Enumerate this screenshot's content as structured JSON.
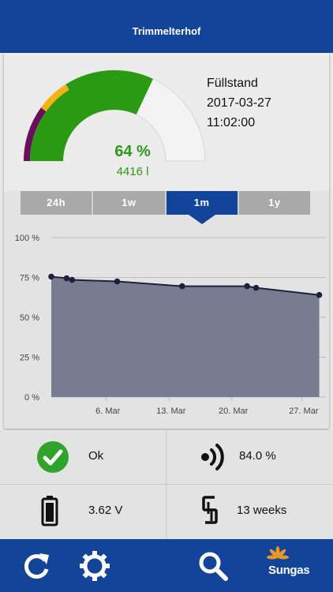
{
  "header": {
    "title": "Trimmelterhof"
  },
  "gauge": {
    "level_percent": 64,
    "percent_text": "64 %",
    "liters_text": "4416 l",
    "colors": {
      "fill": "#2a9a12",
      "warning": "#f5b214",
      "critical": "#6b0f5c",
      "empty": "#f3f3f3"
    }
  },
  "info": {
    "label": "Füllstand",
    "date": "2017-03-27",
    "time": "11:02:00"
  },
  "tabs": [
    {
      "label": "24h",
      "active": false
    },
    {
      "label": "1w",
      "active": false
    },
    {
      "label": "1m",
      "active": true
    },
    {
      "label": "1y",
      "active": false
    }
  ],
  "chart_data": {
    "type": "area",
    "x_ticks": [
      "6. Mar",
      "13. Mar",
      "20. Mar",
      "27. Mar"
    ],
    "y_ticks": [
      "100 %",
      "75 %",
      "50 %",
      "25 %",
      "0 %"
    ],
    "ylim": [
      0,
      100
    ],
    "xlim": [
      0,
      30
    ],
    "points": [
      {
        "x": 0,
        "y": 75.5
      },
      {
        "x": 1.7,
        "y": 74.5
      },
      {
        "x": 2.3,
        "y": 73.5
      },
      {
        "x": 7.3,
        "y": 72.5
      },
      {
        "x": 14.5,
        "y": 69.5
      },
      {
        "x": 21.7,
        "y": 69.5
      },
      {
        "x": 22.7,
        "y": 68.5
      },
      {
        "x": 29.7,
        "y": 64.0
      }
    ],
    "colors": {
      "fill": "#777c91",
      "line": "#1f1f3f"
    }
  },
  "stats": {
    "status": "Ok",
    "signal": "84.0 %",
    "battery": "3.62 V",
    "age": "13 weeks"
  },
  "footer": {
    "brand": "Sungas"
  }
}
